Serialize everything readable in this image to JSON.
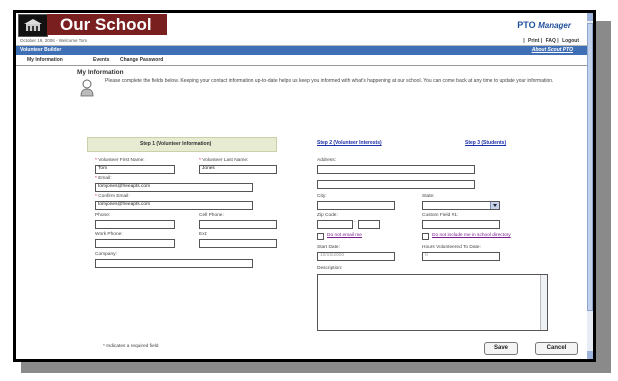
{
  "header": {
    "title": "Our School",
    "brand": "PTO",
    "brand_suffix": "Manager"
  },
  "topbar": {
    "date_welcome": "October 19, 2006 - Welcome Tom",
    "links": [
      "Print",
      "FAQ",
      "Logout"
    ]
  },
  "bluebar": {
    "left": "Volunteer Builder",
    "right": "About Scout PTO"
  },
  "tabs": [
    "My Information",
    "Events",
    "Change Password"
  ],
  "section": {
    "title": "My Information",
    "intro": "Please complete the fields below. Keeping your contact information up-to-date helps us keep you informed with what's happening at our school. You can come back at any time to update your information."
  },
  "steps": [
    "Step 1 (Volunteer Information)",
    "Step 2 (Volunteer Interests)",
    "Step 3 (Students)"
  ],
  "form": {
    "first_name_label": "Volunteer First Name:",
    "first_name_value": "Tom",
    "last_name_label": "Volunteer Last Name:",
    "last_name_value": "Jones",
    "email_label": "Email:",
    "email_value": "tomjones@freeapts.com",
    "confirm_email_label": "Confirm Email:",
    "confirm_email_value": "tomjones@freeapts.com",
    "phone_label": "Phone:",
    "cell_phone_label": "Cell Phone:",
    "work_phone_label": "Work Phone:",
    "ext_label": "Ext:",
    "company_label": "Company:",
    "address_label": "Address:",
    "city_label": "City:",
    "state_label": "State:",
    "zip_label": "Zip Code:",
    "custom_label": "Custom Field #1:",
    "do_not_email_label": "Do not email me",
    "do_not_include_label": "Do not include me in school directory",
    "start_date_label": "Start Date:",
    "start_date_value": "10/15/2006",
    "hours_label": "Hours Volunteered To Date:",
    "hours_value": "0",
    "description_label": "Description:",
    "required_marker": "*"
  },
  "footer": {
    "required_note": "* Indicates a required field",
    "save_label": "Save",
    "cancel_label": "Cancel"
  }
}
